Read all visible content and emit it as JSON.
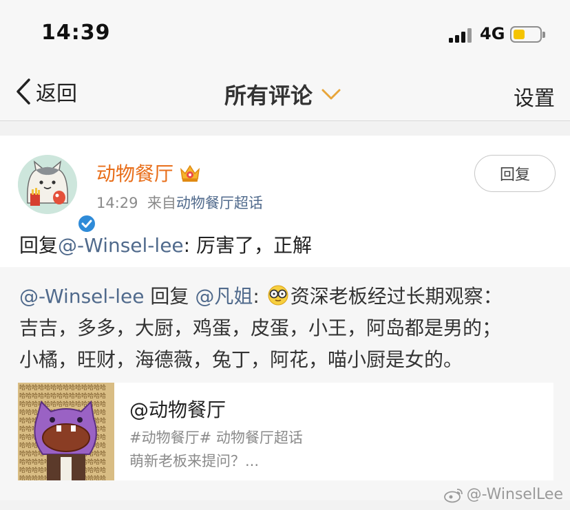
{
  "status_bar": {
    "time": "14:39",
    "network": "4G",
    "battery_color": "#f5c400"
  },
  "nav": {
    "back_label": "返回",
    "title": "所有评论",
    "settings_label": "设置",
    "accent": "#e8a53a"
  },
  "comment": {
    "author": "动物餐厅",
    "author_color": "#e86e1a",
    "time": "14:29",
    "from_prefix": "来自",
    "source": "动物餐厅超话",
    "reply_button": "回复",
    "text_prefix": "回复",
    "mention": "@-Winsel-lee",
    "text_body": ": 厉害了，正解"
  },
  "quote": {
    "user": "@-Winsel-lee",
    "reply_word": "回复",
    "target": "@凡姐",
    "colon": ":",
    "emoji_icon": "glasses-face-icon",
    "line1": "资深老板经过长期观察：",
    "line2": "吉吉，多多，大厨，鸡蛋，皮蛋，小王，阿岛都是男的；",
    "line3": "小橘，旺财，海德薇，兔丁，阿花，喵小厨是女的。"
  },
  "share_card": {
    "title": "@动物餐厅",
    "tags": "#动物餐厅# 动物餐厅超话",
    "desc": "萌新老板来提问？...",
    "thumb_text": "哈哈哈哈哈哈哈哈哈哈哈哈"
  },
  "watermark": "@-WinselLee",
  "colors": {
    "link": "#506a8c",
    "verified": "#2f8bd8"
  }
}
